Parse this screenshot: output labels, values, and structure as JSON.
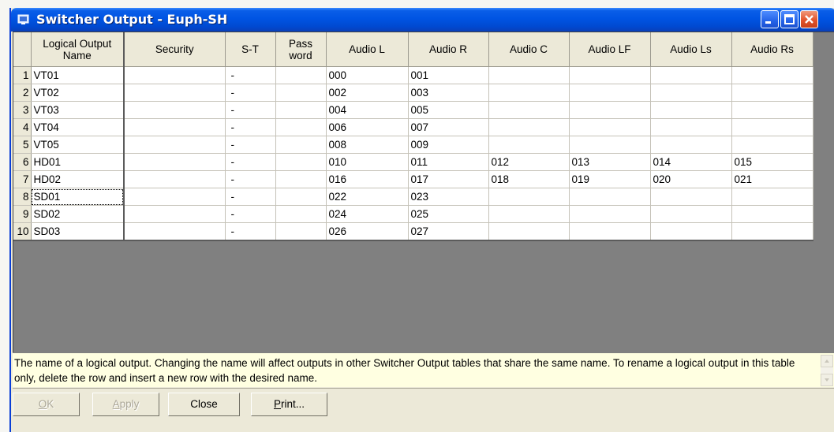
{
  "window": {
    "title": "Switcher Output - Euph-SH"
  },
  "columns": [
    "",
    "Logical Output\nName",
    "Security",
    "S-T",
    "Pass\nword",
    "Audio L",
    "Audio R",
    "Audio C",
    "Audio LF",
    "Audio Ls",
    "Audio Rs"
  ],
  "rows": [
    [
      "1",
      "VT01",
      "",
      "-",
      "",
      "000",
      "001",
      "",
      "",
      "",
      ""
    ],
    [
      "2",
      "VT02",
      "",
      "-",
      "",
      "002",
      "003",
      "",
      "",
      "",
      ""
    ],
    [
      "3",
      "VT03",
      "",
      "-",
      "",
      "004",
      "005",
      "",
      "",
      "",
      ""
    ],
    [
      "4",
      "VT04",
      "",
      "-",
      "",
      "006",
      "007",
      "",
      "",
      "",
      ""
    ],
    [
      "5",
      "VT05",
      "",
      "-",
      "",
      "008",
      "009",
      "",
      "",
      "",
      ""
    ],
    [
      "6",
      "HD01",
      "",
      "-",
      "",
      "010",
      "011",
      "012",
      "013",
      "014",
      "015"
    ],
    [
      "7",
      "HD02",
      "",
      "-",
      "",
      "016",
      "017",
      "018",
      "019",
      "020",
      "021"
    ],
    [
      "8",
      "SD01",
      "",
      "-",
      "",
      "022",
      "023",
      "",
      "",
      "",
      ""
    ],
    [
      "9",
      "SD02",
      "",
      "-",
      "",
      "024",
      "025",
      "",
      "",
      "",
      ""
    ],
    [
      "10",
      "SD03",
      "",
      "-",
      "",
      "026",
      "027",
      "",
      "",
      "",
      ""
    ]
  ],
  "focused_row": 7,
  "help_text": "The name of a logical output.  Changing the name will affect outputs in other Switcher Output tables that share the same name. To rename a logical output in this table only, delete the row and insert a new row with the desired name.",
  "buttons": {
    "ok": {
      "mnemonic": "O",
      "rest": "K"
    },
    "apply": {
      "mnemonic": "A",
      "rest": "pply"
    },
    "close": {
      "label": "Close"
    },
    "print": {
      "mnemonic": "P",
      "rest": "rint..."
    }
  },
  "colors": {
    "titlebar": "#0054e3",
    "help_background": "#ffffe1",
    "grid_background": "#808080",
    "close_button": "#e3532b"
  },
  "icons": [
    "app-icon",
    "minimize-icon",
    "maximize-icon",
    "close-icon",
    "scroll-up-icon",
    "scroll-down-icon"
  ]
}
